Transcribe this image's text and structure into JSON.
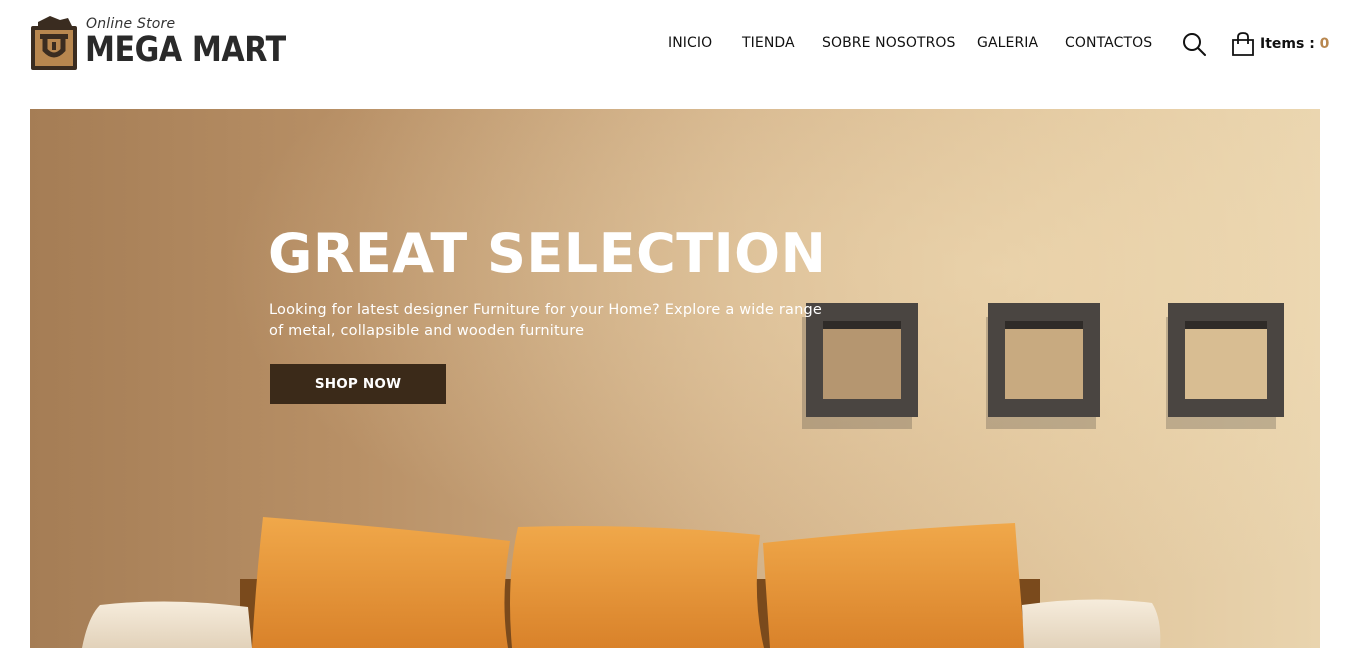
{
  "brand": {
    "tagline": "Online Store",
    "name": "MEGA MART",
    "logo_icon": "shopping-bag-icon"
  },
  "nav": {
    "items": [
      {
        "label": "INICIO"
      },
      {
        "label": "TIENDA"
      },
      {
        "label": "SOBRE NOSOTROS"
      },
      {
        "label": "GALERIA"
      },
      {
        "label": "CONTACTOS"
      }
    ],
    "search_icon": "search-icon"
  },
  "cart": {
    "icon": "shopping-bag-icon",
    "label": "Items :",
    "count": "0"
  },
  "hero": {
    "title": "GREAT SELECTION",
    "text": "Looking for latest designer Furniture for your Home? Explore a wide range of metal, collapsible and wooden furniture",
    "button": "SHOP NOW"
  },
  "colors": {
    "accent": "#b8874f",
    "button_bg": "#3b2a19",
    "pillow": "#e8973a",
    "shelf": "#4a4541"
  }
}
